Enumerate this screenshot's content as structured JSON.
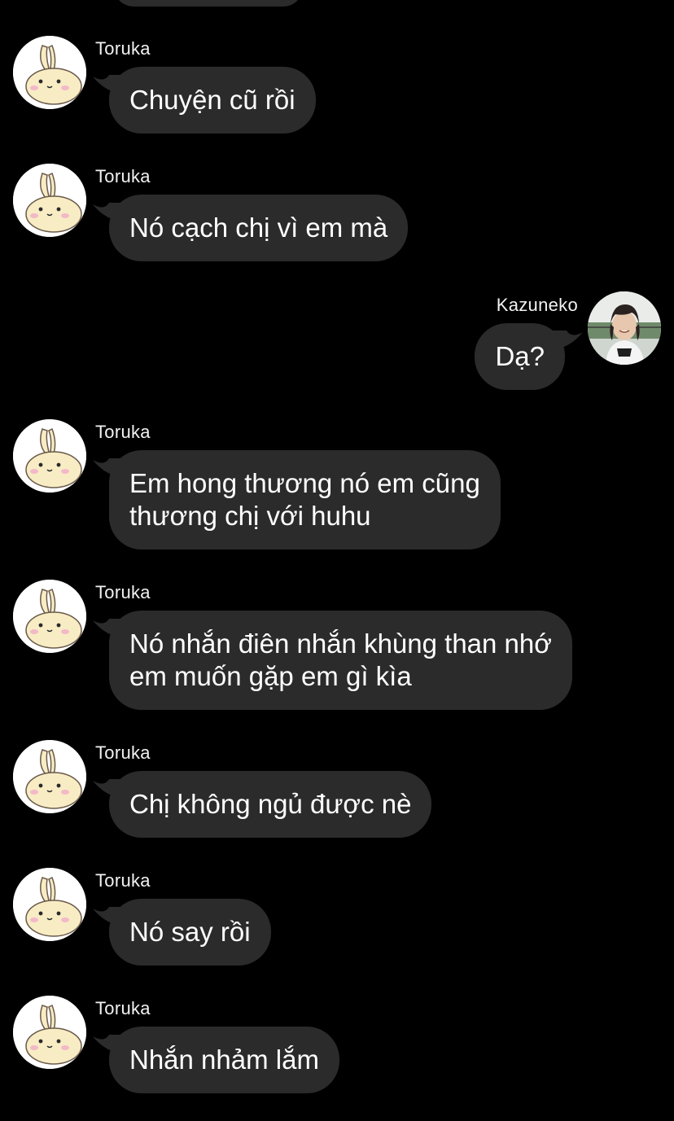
{
  "chat": {
    "colors": {
      "background": "#000000",
      "bubble": "#2b2b2b",
      "text": "#ffffff"
    },
    "messages": [
      {
        "side": "left",
        "sender": "Toruka",
        "avatar": "bunny-avatar-icon",
        "lines": [
          "Chuyện cũ rồi"
        ]
      },
      {
        "side": "left",
        "sender": "Toruka",
        "avatar": "bunny-avatar-icon",
        "lines": [
          "Nó cạch chị vì em mà"
        ]
      },
      {
        "side": "right",
        "sender": "Kazuneko",
        "avatar": "person-photo-avatar",
        "lines": [
          "Dạ?"
        ]
      },
      {
        "side": "left",
        "sender": "Toruka",
        "avatar": "bunny-avatar-icon",
        "lines": [
          "Em hong thương nó em cũng",
          "thương chị với huhu"
        ]
      },
      {
        "side": "left",
        "sender": "Toruka",
        "avatar": "bunny-avatar-icon",
        "lines": [
          "Nó nhắn điên nhắn khùng than nhớ",
          "em muốn gặp em gì kìa"
        ]
      },
      {
        "side": "left",
        "sender": "Toruka",
        "avatar": "bunny-avatar-icon",
        "lines": [
          "Chị không ngủ được nè"
        ]
      },
      {
        "side": "left",
        "sender": "Toruka",
        "avatar": "bunny-avatar-icon",
        "lines": [
          "Nó say rồi"
        ]
      },
      {
        "side": "left",
        "sender": "Toruka",
        "avatar": "bunny-avatar-icon",
        "lines": [
          "Nhắn nhảm lắm"
        ]
      }
    ]
  }
}
